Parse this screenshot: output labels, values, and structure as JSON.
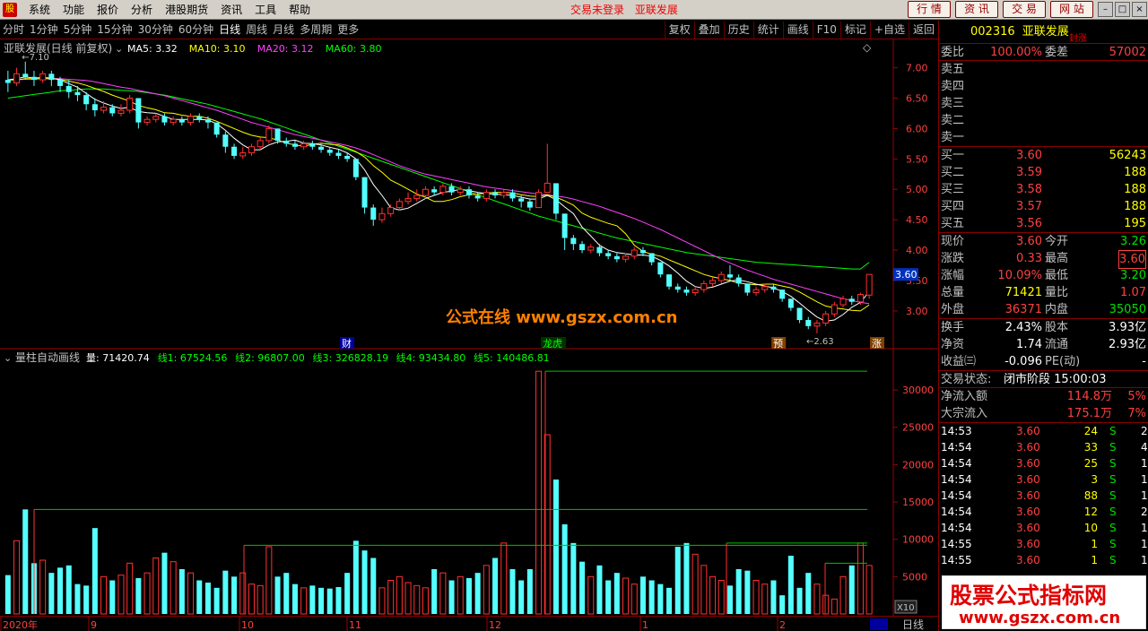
{
  "menu": {
    "items": [
      "系统",
      "功能",
      "报价",
      "分析",
      "港股期货",
      "资讯",
      "工具",
      "帮助"
    ],
    "status_login": "交易未登录",
    "status_stock": "亚联发展",
    "top_buttons": [
      "行 情",
      "资 讯",
      "交 易",
      "网 站"
    ]
  },
  "toolbar": {
    "periods": [
      "分时",
      "1分钟",
      "5分钟",
      "15分钟",
      "30分钟",
      "60分钟",
      "日线",
      "周线",
      "月线",
      "多周期",
      "更多"
    ],
    "active_period": "日线",
    "tools": [
      "复权",
      "叠加",
      "历史",
      "统计",
      "画线",
      "F10",
      "标记",
      "+自选",
      "返回"
    ]
  },
  "main_chart": {
    "title": "亚联发展(日线 前复权)",
    "ma_labels": [
      {
        "text": "MA5: 3.32",
        "color": "#ffffff"
      },
      {
        "text": "MA10: 3.10",
        "color": "#ffff00"
      },
      {
        "text": "MA20: 3.12",
        "color": "#ff40ff"
      },
      {
        "text": "MA60: 3.80",
        "color": "#00ff00"
      }
    ],
    "high_label": "7.10",
    "low_label": "2.63",
    "current_price_tag": "3.60",
    "y_ticks": [
      "7.00",
      "6.50",
      "6.00",
      "5.50",
      "5.00",
      "4.50",
      "4.00",
      "3.50",
      "3.00"
    ],
    "markers": [
      {
        "text": "财",
        "pos": "0.37"
      },
      {
        "text": "龙虎",
        "pos": "0.59"
      },
      {
        "text": "预",
        "pos": "0.83"
      },
      {
        "text": "涨",
        "pos": "0.935"
      }
    ]
  },
  "vol_chart": {
    "title": "量柱自动画线",
    "labels": [
      {
        "text": "量: 71420.74",
        "color": "#ffffff"
      },
      {
        "text": "线1: 67524.56",
        "color": "#00ff00"
      },
      {
        "text": "线2: 96807.00",
        "color": "#00ff00"
      },
      {
        "text": "线3: 326828.19",
        "color": "#00ff00"
      },
      {
        "text": "线4: 93434.80",
        "color": "#00ff00"
      },
      {
        "text": "线5: 140486.81",
        "color": "#00ff00"
      }
    ],
    "y_ticks": [
      "30000",
      "25000",
      "20000",
      "15000",
      "10000",
      "5000"
    ],
    "unit": "X10"
  },
  "x_axis": {
    "labels": [
      "2020年",
      "9",
      "10",
      "11",
      "12",
      "1",
      "2"
    ],
    "period_label": "日线"
  },
  "panel": {
    "code": "002316",
    "name": "亚联发展",
    "badge": "封涨",
    "weibi": {
      "label": "委比",
      "value": "100.00%",
      "label2": "委差",
      "value2": "57002"
    },
    "sells": [
      {
        "label": "卖五",
        "price": "",
        "vol": ""
      },
      {
        "label": "卖四",
        "price": "",
        "vol": ""
      },
      {
        "label": "卖三",
        "price": "",
        "vol": ""
      },
      {
        "label": "卖二",
        "price": "",
        "vol": ""
      },
      {
        "label": "卖一",
        "price": "",
        "vol": ""
      }
    ],
    "buys": [
      {
        "label": "买一",
        "price": "3.60",
        "vol": "56243"
      },
      {
        "label": "买二",
        "price": "3.59",
        "vol": "188"
      },
      {
        "label": "买三",
        "price": "3.58",
        "vol": "188"
      },
      {
        "label": "买四",
        "price": "3.57",
        "vol": "188"
      },
      {
        "label": "买五",
        "price": "3.56",
        "vol": "195"
      }
    ],
    "quote": [
      {
        "l1": "现价",
        "v1": "3.60",
        "c1": "red",
        "l2": "今开",
        "v2": "3.26",
        "c2": "green"
      },
      {
        "l1": "涨跌",
        "v1": "0.33",
        "c1": "red",
        "l2": "最高",
        "v2": "3.60",
        "c2": "red"
      },
      {
        "l1": "涨幅",
        "v1": "10.09%",
        "c1": "red",
        "l2": "最低",
        "v2": "3.20",
        "c2": "green"
      },
      {
        "l1": "总量",
        "v1": "71421",
        "c1": "yellow",
        "l2": "量比",
        "v2": "1.07",
        "c2": "red"
      },
      {
        "l1": "外盘",
        "v1": "36371",
        "c1": "red",
        "l2": "内盘",
        "v2": "35050",
        "c2": "green"
      }
    ],
    "fundamentals": [
      {
        "l1": "换手",
        "v1": "2.43%",
        "l2": "股本",
        "v2": "3.93亿"
      },
      {
        "l1": "净资",
        "v1": "1.74",
        "l2": "流通",
        "v2": "2.93亿"
      },
      {
        "l1": "收益㈢",
        "v1": "-0.096",
        "l2": "PE(动)",
        "v2": "-"
      }
    ],
    "trade_status": {
      "label": "交易状态:",
      "value": "闭市阶段 15:00:03"
    },
    "flows": [
      {
        "label": "净流入额",
        "value": "114.8万",
        "pct": "5%"
      },
      {
        "label": "大宗流入",
        "value": "175.1万",
        "pct": "7%"
      }
    ],
    "ticks": [
      {
        "time": "14:53",
        "price": "3.60",
        "vol": "24",
        "side": "S",
        "n": "2"
      },
      {
        "time": "14:54",
        "price": "3.60",
        "vol": "33",
        "side": "S",
        "n": "4"
      },
      {
        "time": "14:54",
        "price": "3.60",
        "vol": "25",
        "side": "S",
        "n": "1"
      },
      {
        "time": "14:54",
        "price": "3.60",
        "vol": "3",
        "side": "S",
        "n": "1"
      },
      {
        "time": "14:54",
        "price": "3.60",
        "vol": "88",
        "side": "S",
        "n": "1"
      },
      {
        "time": "14:54",
        "price": "3.60",
        "vol": "12",
        "side": "S",
        "n": "2"
      },
      {
        "time": "14:54",
        "price": "3.60",
        "vol": "10",
        "side": "S",
        "n": "1"
      },
      {
        "time": "14:55",
        "price": "3.60",
        "vol": "1",
        "side": "S",
        "n": "1"
      },
      {
        "time": "14:55",
        "price": "3.60",
        "vol": "1",
        "side": "S",
        "n": "1"
      }
    ]
  },
  "watermark": {
    "center": "公式在线 www.gszx.com.cn",
    "corner_title": "股票公式指标网",
    "corner_url": "www.gszx.com.cn"
  },
  "chart_data": {
    "type": "candlestick",
    "price_range": [
      2.6,
      7.2
    ],
    "volume_range": [
      0,
      33000
    ],
    "candles": [
      [
        6.8,
        6.75,
        6.95,
        6.6
      ],
      [
        6.75,
        6.9,
        7.0,
        6.7
      ],
      [
        6.9,
        6.85,
        7.1,
        6.8
      ],
      [
        6.85,
        6.8,
        6.95,
        6.7
      ],
      [
        6.8,
        6.9,
        6.95,
        6.75
      ],
      [
        6.9,
        6.8,
        6.95,
        6.7
      ],
      [
        6.8,
        6.7,
        6.85,
        6.6
      ],
      [
        6.7,
        6.6,
        6.8,
        6.5
      ],
      [
        6.6,
        6.55,
        6.7,
        6.45
      ],
      [
        6.55,
        6.4,
        6.6,
        6.3
      ],
      [
        6.4,
        6.3,
        6.5,
        6.2
      ],
      [
        6.3,
        6.35,
        6.45,
        6.25
      ],
      [
        6.35,
        6.25,
        6.4,
        6.2
      ],
      [
        6.25,
        6.3,
        6.4,
        6.2
      ],
      [
        6.3,
        6.5,
        6.55,
        6.25
      ],
      [
        6.5,
        6.1,
        6.5,
        6.0
      ],
      [
        6.1,
        6.15,
        6.2,
        6.05
      ],
      [
        6.15,
        6.2,
        6.25,
        6.1
      ],
      [
        6.2,
        6.1,
        6.25,
        6.05
      ],
      [
        6.1,
        6.15,
        6.2,
        6.05
      ],
      [
        6.15,
        6.1,
        6.2,
        6.05
      ],
      [
        6.1,
        6.2,
        6.25,
        6.05
      ],
      [
        6.2,
        6.15,
        6.25,
        6.1
      ],
      [
        6.15,
        6.1,
        6.2,
        6.0
      ],
      [
        6.1,
        5.9,
        6.1,
        5.85
      ],
      [
        5.9,
        5.7,
        5.95,
        5.6
      ],
      [
        5.7,
        5.55,
        5.75,
        5.5
      ],
      [
        5.55,
        5.6,
        5.7,
        5.5
      ],
      [
        5.6,
        5.7,
        5.75,
        5.55
      ],
      [
        5.7,
        5.8,
        5.85,
        5.65
      ],
      [
        5.8,
        6.0,
        6.05,
        5.75
      ],
      [
        6.0,
        5.8,
        6.0,
        5.75
      ],
      [
        5.8,
        5.75,
        5.85,
        5.7
      ],
      [
        5.75,
        5.7,
        5.8,
        5.65
      ],
      [
        5.7,
        5.75,
        5.8,
        5.65
      ],
      [
        5.75,
        5.7,
        5.8,
        5.65
      ],
      [
        5.7,
        5.65,
        5.75,
        5.6
      ],
      [
        5.65,
        5.6,
        5.7,
        5.55
      ],
      [
        5.6,
        5.55,
        5.65,
        5.5
      ],
      [
        5.55,
        5.5,
        5.6,
        5.45
      ],
      [
        5.5,
        5.2,
        5.5,
        5.15
      ],
      [
        5.2,
        4.7,
        5.2,
        4.6
      ],
      [
        4.7,
        4.5,
        4.75,
        4.4
      ],
      [
        4.5,
        4.6,
        4.7,
        4.45
      ],
      [
        4.6,
        4.7,
        4.75,
        4.55
      ],
      [
        4.7,
        4.8,
        4.85,
        4.65
      ],
      [
        4.8,
        4.85,
        4.95,
        4.75
      ],
      [
        4.85,
        4.9,
        5.0,
        4.8
      ],
      [
        4.9,
        5.0,
        5.05,
        4.85
      ],
      [
        5.0,
        4.95,
        5.05,
        4.9
      ],
      [
        4.95,
        5.05,
        5.1,
        4.9
      ],
      [
        5.05,
        4.95,
        5.1,
        4.9
      ],
      [
        4.95,
        5.0,
        5.05,
        4.9
      ],
      [
        5.0,
        4.9,
        5.05,
        4.85
      ],
      [
        4.9,
        4.85,
        4.95,
        4.8
      ],
      [
        4.85,
        4.95,
        5.0,
        4.8
      ],
      [
        4.95,
        4.9,
        5.0,
        4.85
      ],
      [
        4.9,
        4.95,
        5.0,
        4.85
      ],
      [
        4.95,
        4.85,
        5.0,
        4.8
      ],
      [
        4.85,
        4.8,
        4.9,
        4.7
      ],
      [
        4.8,
        4.7,
        4.85,
        4.65
      ],
      [
        4.7,
        4.95,
        5.0,
        4.7
      ],
      [
        4.95,
        5.1,
        5.75,
        4.95
      ],
      [
        5.1,
        4.6,
        5.1,
        4.5
      ],
      [
        4.6,
        4.2,
        4.6,
        4.0
      ],
      [
        4.2,
        4.1,
        4.25,
        4.0
      ],
      [
        4.1,
        4.0,
        4.15,
        3.95
      ],
      [
        4.0,
        4.05,
        4.1,
        3.95
      ],
      [
        4.05,
        3.95,
        4.1,
        3.9
      ],
      [
        3.95,
        3.9,
        4.0,
        3.85
      ],
      [
        3.9,
        3.85,
        3.95,
        3.8
      ],
      [
        3.85,
        3.9,
        3.95,
        3.8
      ],
      [
        3.9,
        4.0,
        4.05,
        3.85
      ],
      [
        4.0,
        3.95,
        4.05,
        3.9
      ],
      [
        3.95,
        3.8,
        3.95,
        3.75
      ],
      [
        3.8,
        3.6,
        3.8,
        3.55
      ],
      [
        3.6,
        3.4,
        3.6,
        3.35
      ],
      [
        3.4,
        3.35,
        3.45,
        3.3
      ],
      [
        3.35,
        3.3,
        3.4,
        3.25
      ],
      [
        3.3,
        3.35,
        3.4,
        3.25
      ],
      [
        3.35,
        3.45,
        3.5,
        3.3
      ],
      [
        3.45,
        3.5,
        3.55,
        3.4
      ],
      [
        3.5,
        3.6,
        3.65,
        3.45
      ],
      [
        3.6,
        3.55,
        3.75,
        3.5
      ],
      [
        3.55,
        3.45,
        3.6,
        3.4
      ],
      [
        3.45,
        3.3,
        3.45,
        3.25
      ],
      [
        3.3,
        3.35,
        3.4,
        3.25
      ],
      [
        3.35,
        3.4,
        3.45,
        3.3
      ],
      [
        3.4,
        3.35,
        3.45,
        3.3
      ],
      [
        3.35,
        3.2,
        3.35,
        3.15
      ],
      [
        3.2,
        3.05,
        3.2,
        3.0
      ],
      [
        3.05,
        2.85,
        3.05,
        2.8
      ],
      [
        2.85,
        2.75,
        2.9,
        2.7
      ],
      [
        2.75,
        2.8,
        2.85,
        2.63
      ],
      [
        2.8,
        2.95,
        3.0,
        2.75
      ],
      [
        2.95,
        3.1,
        3.15,
        2.9
      ],
      [
        3.1,
        3.2,
        3.25,
        3.05
      ],
      [
        3.2,
        3.15,
        3.25,
        3.1
      ],
      [
        3.15,
        3.27,
        3.3,
        3.1
      ],
      [
        3.26,
        3.6,
        3.6,
        3.2
      ]
    ],
    "ma5": [
      6.8,
      6.82,
      6.85,
      6.83,
      6.84,
      6.83,
      6.8,
      6.74,
      6.68,
      6.58,
      6.48,
      6.42,
      6.37,
      6.33,
      6.35,
      6.28,
      6.26,
      6.25,
      6.2,
      6.15,
      6.15,
      6.15,
      6.15,
      6.14,
      6.08,
      5.97,
      5.84,
      5.73,
      5.65,
      5.65,
      5.73,
      5.78,
      5.79,
      5.81,
      5.76,
      5.75,
      5.73,
      5.69,
      5.66,
      5.6,
      5.5,
      5.32,
      5.08,
      4.9,
      4.7,
      4.66,
      4.69,
      4.77,
      4.85,
      4.9,
      4.95,
      4.97,
      5.0,
      4.98,
      4.95,
      4.93,
      4.92,
      4.91,
      4.9,
      4.87,
      4.84,
      4.84,
      4.9,
      4.83,
      4.71,
      4.6,
      4.38,
      4.23,
      4.08,
      4.0,
      3.96,
      3.94,
      3.92,
      3.92,
      3.9,
      3.83,
      3.74,
      3.62,
      3.49,
      3.4,
      3.37,
      3.39,
      3.44,
      3.49,
      3.51,
      3.48,
      3.44,
      3.41,
      3.38,
      3.32,
      3.24,
      3.13,
      3.01,
      2.9,
      2.83,
      2.85,
      2.94,
      3.06,
      3.14,
      3.32
    ],
    "ma10": [
      6.8,
      6.8,
      6.82,
      6.82,
      6.82,
      6.82,
      6.81,
      6.78,
      6.75,
      6.71,
      6.66,
      6.61,
      6.55,
      6.5,
      6.45,
      6.38,
      6.34,
      6.31,
      6.26,
      6.25,
      6.22,
      6.2,
      6.2,
      6.17,
      6.12,
      6.06,
      6.0,
      5.94,
      5.89,
      5.86,
      5.85,
      5.81,
      5.76,
      5.73,
      5.71,
      5.74,
      5.76,
      5.74,
      5.73,
      5.68,
      5.62,
      5.53,
      5.39,
      5.28,
      5.15,
      5.08,
      5.0,
      4.92,
      4.87,
      4.8,
      4.8,
      4.83,
      4.88,
      4.91,
      4.92,
      4.94,
      4.95,
      4.95,
      4.94,
      4.91,
      4.89,
      4.88,
      4.91,
      4.87,
      4.81,
      4.74,
      4.61,
      4.54,
      4.49,
      4.44,
      4.4,
      4.27,
      4.08,
      3.98,
      3.93,
      3.9,
      3.84,
      3.78,
      3.72,
      3.66,
      3.6,
      3.56,
      3.53,
      3.5,
      3.46,
      3.44,
      3.43,
      3.44,
      3.44,
      3.41,
      3.38,
      3.31,
      3.23,
      3.15,
      3.08,
      3.05,
      3.03,
      3.01,
      3.0,
      3.1
    ],
    "ma20": [
      6.8,
      6.8,
      6.81,
      6.81,
      6.82,
      6.82,
      6.82,
      6.81,
      6.8,
      6.79,
      6.77,
      6.74,
      6.71,
      6.68,
      6.66,
      6.63,
      6.6,
      6.57,
      6.54,
      6.5,
      6.46,
      6.42,
      6.38,
      6.34,
      6.3,
      6.25,
      6.2,
      6.15,
      6.1,
      6.06,
      6.02,
      5.98,
      5.94,
      5.9,
      5.87,
      5.84,
      5.81,
      5.78,
      5.75,
      5.72,
      5.68,
      5.63,
      5.57,
      5.51,
      5.45,
      5.39,
      5.34,
      5.29,
      5.25,
      5.22,
      5.19,
      5.16,
      5.13,
      5.1,
      5.07,
      5.04,
      5.02,
      5.0,
      4.98,
      4.96,
      4.94,
      4.92,
      4.91,
      4.89,
      4.87,
      4.84,
      4.8,
      4.76,
      4.72,
      4.67,
      4.62,
      4.57,
      4.52,
      4.46,
      4.4,
      4.34,
      4.27,
      4.2,
      4.13,
      4.06,
      3.99,
      3.92,
      3.85,
      3.79,
      3.73,
      3.67,
      3.62,
      3.57,
      3.52,
      3.48,
      3.44,
      3.4,
      3.36,
      3.32,
      3.28,
      3.24,
      3.2,
      3.17,
      3.14,
      3.12
    ],
    "ma60": [
      6.5,
      6.52,
      6.54,
      6.56,
      6.58,
      6.6,
      6.62,
      6.63,
      6.64,
      6.65,
      6.65,
      6.65,
      6.64,
      6.63,
      6.62,
      6.61,
      6.59,
      6.57,
      6.55,
      6.52,
      6.49,
      6.46,
      6.43,
      6.4,
      6.36,
      6.32,
      6.28,
      6.24,
      6.2,
      6.16,
      6.11,
      6.06,
      6.01,
      5.96,
      5.91,
      5.86,
      5.81,
      5.76,
      5.71,
      5.66,
      5.61,
      5.56,
      5.51,
      5.46,
      5.41,
      5.36,
      5.31,
      5.26,
      5.21,
      5.16,
      5.11,
      5.06,
      5.01,
      4.96,
      4.91,
      4.86,
      4.81,
      4.76,
      4.71,
      4.66,
      4.61,
      4.56,
      4.52,
      4.48,
      4.44,
      4.4,
      4.36,
      4.32,
      4.28,
      4.24,
      4.2,
      4.17,
      4.14,
      4.11,
      4.08,
      4.05,
      4.02,
      3.99,
      3.96,
      3.94,
      3.92,
      3.9,
      3.88,
      3.86,
      3.84,
      3.82,
      3.8,
      3.79,
      3.78,
      3.77,
      3.76,
      3.75,
      3.74,
      3.73,
      3.72,
      3.71,
      3.7,
      3.69,
      3.69,
      3.8
    ],
    "volumes": [
      5200,
      9800,
      14000,
      6800,
      7200,
      5500,
      6200,
      6500,
      4000,
      3800,
      11500,
      5000,
      4500,
      5200,
      6800,
      4800,
      5500,
      7500,
      8200,
      7000,
      6000,
      5500,
      4500,
      4200,
      3500,
      5800,
      5000,
      5500,
      4000,
      3800,
      9000,
      5000,
      5500,
      4000,
      3500,
      3800,
      3500,
      3400,
      3600,
      5500,
      9800,
      8500,
      7500,
      3500,
      4500,
      5000,
      4200,
      3800,
      3500,
      6000,
      5500,
      4500,
      5000,
      4800,
      5500,
      6500,
      7500,
      9500,
      6000,
      4500,
      6000,
      32500,
      24000,
      18000,
      12000,
      9500,
      7000,
      5000,
      6500,
      4500,
      5500,
      4800,
      4000,
      5000,
      4500,
      4000,
      3500,
      9000,
      9500,
      8000,
      6500,
      5000,
      4500,
      3800,
      6000,
      5800,
      4500,
      4000,
      4500,
      2500,
      7800,
      3500,
      5500,
      4000,
      2500,
      2000,
      5000,
      6500,
      9500,
      6500
    ],
    "vol_lines": [
      {
        "name": "线1",
        "from": 38,
        "to": 967,
        "value": 14000
      },
      {
        "name": "线2",
        "from": 272,
        "to": 967,
        "value": 9200
      },
      {
        "name": "线3",
        "from": 608,
        "to": 967,
        "value": 32500
      },
      {
        "name": "线4",
        "from": 810,
        "to": 967,
        "value": 9500
      },
      {
        "name": "线5",
        "from": 920,
        "to": 967,
        "value": 6800
      }
    ]
  }
}
